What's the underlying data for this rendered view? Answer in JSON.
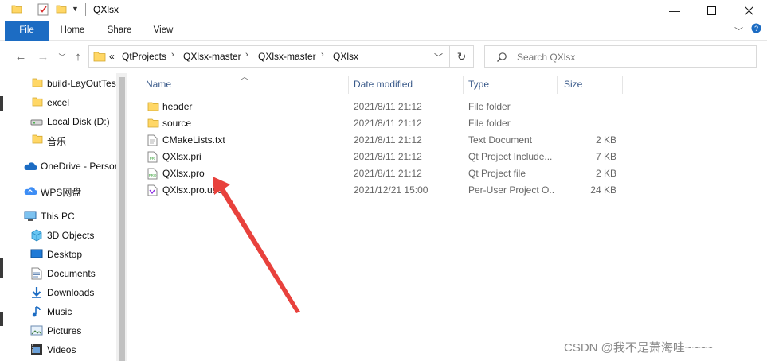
{
  "window": {
    "title": "QXlsx"
  },
  "ribbon": {
    "tabs": [
      "File",
      "Home",
      "Share",
      "View"
    ]
  },
  "address": {
    "overflow": "«",
    "crumbs": [
      "QtProjects",
      "QXlsx-master",
      "QXlsx-master",
      "QXlsx"
    ]
  },
  "search": {
    "placeholder": "Search QXlsx"
  },
  "nav": {
    "items": [
      {
        "label": "build-LayOutTes",
        "icon": "folder-icon"
      },
      {
        "label": "excel",
        "icon": "folder-icon"
      },
      {
        "label": "Local Disk (D:)",
        "icon": "drive-icon"
      },
      {
        "label": "音乐",
        "icon": "folder-icon"
      },
      {
        "label": "OneDrive - Persor",
        "icon": "cloud-icon"
      },
      {
        "label": "WPS网盘",
        "icon": "wps-cloud-icon"
      },
      {
        "label": "This PC",
        "icon": "pc-icon"
      },
      {
        "label": "3D Objects",
        "icon": "3d-objects-icon"
      },
      {
        "label": "Desktop",
        "icon": "desktop-icon"
      },
      {
        "label": "Documents",
        "icon": "documents-icon"
      },
      {
        "label": "Downloads",
        "icon": "downloads-icon"
      },
      {
        "label": "Music",
        "icon": "music-icon"
      },
      {
        "label": "Pictures",
        "icon": "pictures-icon"
      },
      {
        "label": "Videos",
        "icon": "videos-icon"
      }
    ]
  },
  "list": {
    "columns": {
      "name": "Name",
      "date": "Date modified",
      "type": "Type",
      "size": "Size"
    },
    "rows": [
      {
        "name": "header",
        "date": "2021/8/11 21:12",
        "type": "File folder",
        "size": "",
        "icon": "folder-icon"
      },
      {
        "name": "source",
        "date": "2021/8/11 21:12",
        "type": "File folder",
        "size": "",
        "icon": "folder-icon"
      },
      {
        "name": "CMakeLists.txt",
        "date": "2021/8/11 21:12",
        "type": "Text Document",
        "size": "2 KB",
        "icon": "text-file-icon"
      },
      {
        "name": "QXlsx.pri",
        "date": "2021/8/11 21:12",
        "type": "Qt Project Include...",
        "size": "7 KB",
        "icon": "pri-file-icon"
      },
      {
        "name": "QXlsx.pro",
        "date": "2021/8/11 21:12",
        "type": "Qt Project file",
        "size": "2 KB",
        "icon": "pro-file-icon"
      },
      {
        "name": "QXlsx.pro.user",
        "date": "2021/12/21 15:00",
        "type": "Per-User Project O...",
        "size": "24 KB",
        "icon": "user-file-icon"
      }
    ]
  },
  "watermark": "CSDN @我不是萧海哇~~~~",
  "colors": {
    "accent": "#1c6cc3",
    "folder": "#ffd766",
    "annotation_arrow": "#e8413c"
  }
}
